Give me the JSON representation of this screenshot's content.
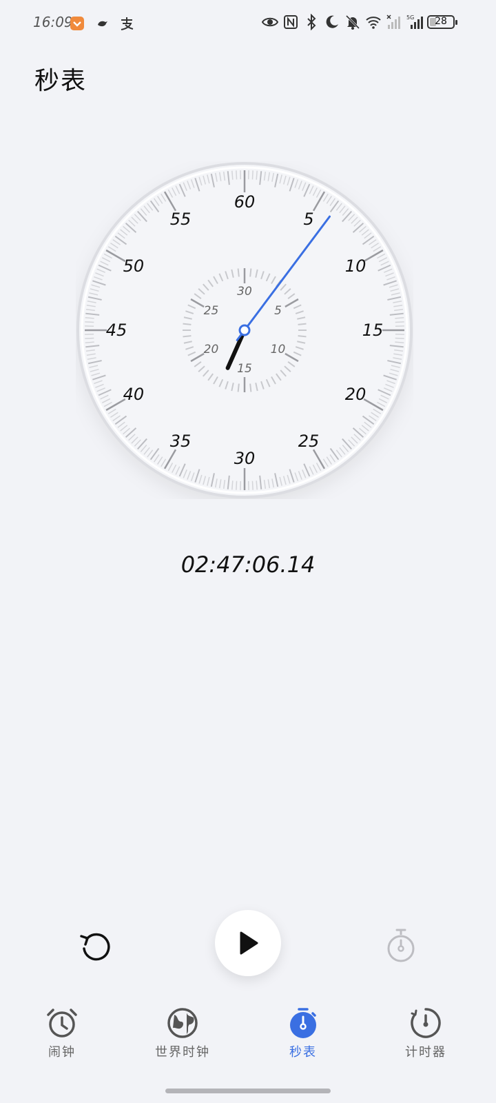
{
  "status_bar": {
    "time": "16:09",
    "left_icons": [
      "app-notification-icon",
      "bird-icon",
      "alipay-icon"
    ],
    "right_icons": [
      "eye-icon",
      "nfc-icon",
      "bluetooth-icon",
      "moon-icon",
      "bell-off-icon",
      "wifi-icon",
      "signal-icon",
      "signal-5g-icon"
    ],
    "battery": "28",
    "battery_level": 0.28
  },
  "page": {
    "title": "秒表"
  },
  "dial": {
    "outer_labels": [
      "60",
      "5",
      "10",
      "15",
      "20",
      "25",
      "30",
      "35",
      "40",
      "45",
      "50",
      "55"
    ],
    "inner_labels": [
      "30",
      "5",
      "10",
      "15",
      "20",
      "25"
    ],
    "second_hand_seconds": 6.14,
    "minute_hand_minutes": 17,
    "accent": "#3a6fe2"
  },
  "elapsed_time": "02:47:06.14",
  "controls": {
    "reset_icon": "reset-icon",
    "play_icon": "play-icon",
    "lap_icon": "stopwatch-lap-icon"
  },
  "nav": {
    "items": [
      {
        "label": "闹钟",
        "icon": "alarm-clock-icon",
        "active": false
      },
      {
        "label": "世界时钟",
        "icon": "globe-icon",
        "active": false
      },
      {
        "label": "秒表",
        "icon": "stopwatch-icon",
        "active": true
      },
      {
        "label": "计时器",
        "icon": "timer-icon",
        "active": false
      }
    ]
  }
}
